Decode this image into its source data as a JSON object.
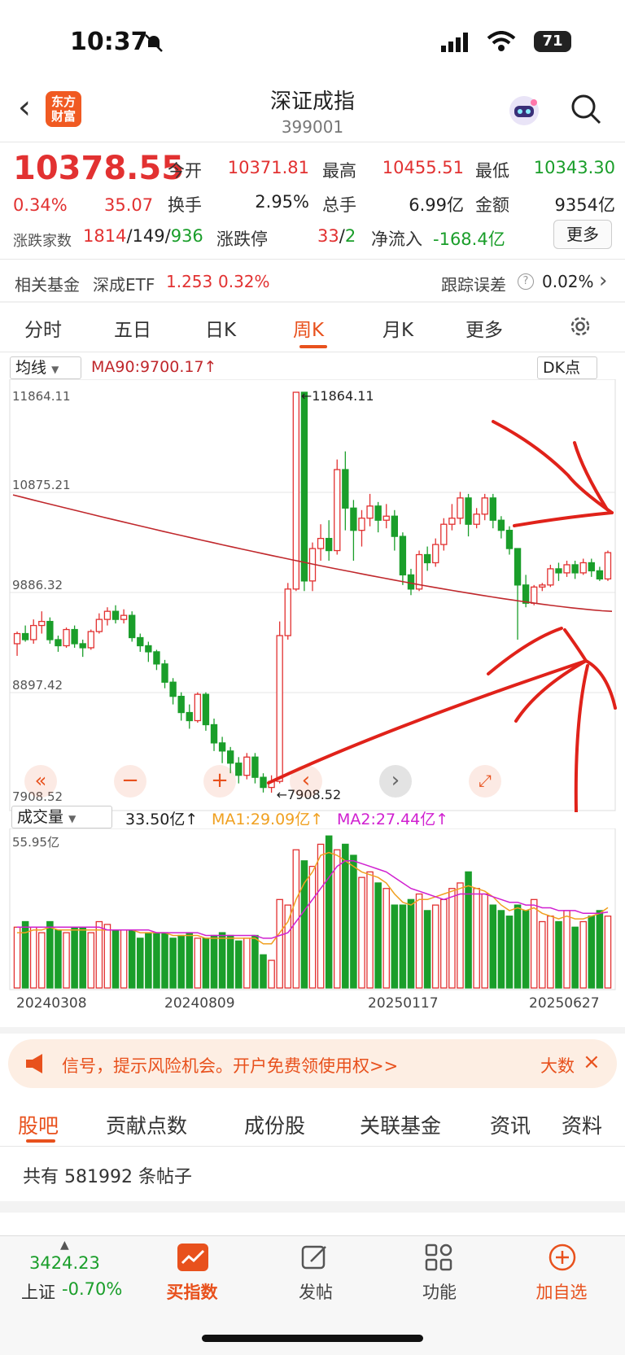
{
  "status": {
    "time": "10:37",
    "battery": "71"
  },
  "header": {
    "logo": "东方财富",
    "title": "深证成指",
    "code": "399001"
  },
  "quote": {
    "price": "10378.55",
    "change_pct": "0.34%",
    "change": "35.07",
    "rows": [
      [
        {
          "label": "今开",
          "value": "10371.81",
          "color": "red"
        },
        {
          "label": "最高",
          "value": "10455.51",
          "color": "red"
        },
        {
          "label": "最低",
          "value": "10343.30",
          "color": "green"
        }
      ],
      [
        {
          "label": "换手",
          "value": "2.95%",
          "color": "black"
        },
        {
          "label": "总手",
          "value": "6.99亿",
          "color": "black"
        },
        {
          "label": "金额",
          "value": "9354亿",
          "color": "black"
        }
      ]
    ],
    "breadth_label": "涨跌家数",
    "breadth_up": "1814",
    "breadth_flat": "149",
    "breadth_down": "936",
    "limit_label": "涨跌停",
    "limit_up": "33",
    "limit_down": "2",
    "netflow_label": "净流入",
    "netflow": "-168.4亿",
    "more": "更多"
  },
  "fund": {
    "label": "相关基金",
    "name": "深成ETF",
    "price": "1.253",
    "pct": "0.32%",
    "track_label": "跟踪误差",
    "track_val": "0.02%"
  },
  "tabs": [
    "分时",
    "五日",
    "日K",
    "周K",
    "月K",
    "更多"
  ],
  "active_tab": "周K",
  "chart_controls": {
    "ma_select": "均线",
    "ma90": "MA90:9700.17↑",
    "dk": "DK点"
  },
  "chart_data": [
    {
      "type": "candlestick",
      "y_ticks": [
        "11864.11",
        "10875.21",
        "9886.32",
        "8897.42",
        "7908.52"
      ],
      "ylim": [
        7908.52,
        11864.11
      ],
      "high_label": "←11864.11",
      "low_label": "←7908.52",
      "ma90_start": 10850,
      "ma90_end": 9700.17,
      "candles": [
        [
          9380,
          9480,
          9260,
          9500
        ],
        [
          9480,
          9420,
          9400,
          9560
        ],
        [
          9420,
          9560,
          9380,
          9620
        ],
        [
          9560,
          9600,
          9480,
          9700
        ],
        [
          9600,
          9420,
          9380,
          9640
        ],
        [
          9420,
          9360,
          9300,
          9460
        ],
        [
          9360,
          9520,
          9340,
          9540
        ],
        [
          9520,
          9380,
          9340,
          9560
        ],
        [
          9380,
          9340,
          9250,
          9420
        ],
        [
          9340,
          9500,
          9320,
          9520
        ],
        [
          9500,
          9620,
          9480,
          9680
        ],
        [
          9620,
          9700,
          9560,
          9740
        ],
        [
          9700,
          9620,
          9580,
          9760
        ],
        [
          9620,
          9660,
          9580,
          9720
        ],
        [
          9660,
          9440,
          9400,
          9700
        ],
        [
          9440,
          9360,
          9300,
          9480
        ],
        [
          9360,
          9300,
          9200,
          9400
        ],
        [
          9300,
          9180,
          9120,
          9320
        ],
        [
          9180,
          9000,
          8940,
          9220
        ],
        [
          9000,
          8860,
          8780,
          9040
        ],
        [
          8860,
          8700,
          8620,
          8900
        ],
        [
          8700,
          8620,
          8540,
          8780
        ],
        [
          8620,
          8880,
          8600,
          8900
        ],
        [
          8880,
          8580,
          8520,
          8900
        ],
        [
          8580,
          8400,
          8320,
          8640
        ],
        [
          8400,
          8320,
          8200,
          8460
        ],
        [
          8320,
          8200,
          8100,
          8360
        ],
        [
          8200,
          8080,
          8000,
          8260
        ],
        [
          8080,
          8260,
          8040,
          8300
        ],
        [
          8260,
          8060,
          8000,
          8300
        ],
        [
          8060,
          7960,
          7910,
          8100
        ],
        [
          7960,
          8020,
          7908,
          8080
        ],
        [
          8020,
          9460,
          8000,
          9600
        ],
        [
          9460,
          9920,
          9420,
          9980
        ],
        [
          9920,
          11864,
          9900,
          11864
        ],
        [
          11864,
          10000,
          9900,
          11700
        ],
        [
          10000,
          10320,
          9900,
          10380
        ],
        [
          10320,
          10420,
          10200,
          10560
        ],
        [
          10420,
          10300,
          10200,
          10600
        ],
        [
          10300,
          11100,
          10260,
          11200
        ],
        [
          11100,
          10720,
          10500,
          11280
        ],
        [
          10720,
          10500,
          10200,
          10800
        ],
        [
          10500,
          10620,
          10340,
          10700
        ],
        [
          10620,
          10740,
          10540,
          10860
        ],
        [
          10740,
          10600,
          10480,
          10780
        ],
        [
          10600,
          10640,
          10520,
          10760
        ],
        [
          10640,
          10440,
          10300,
          10700
        ],
        [
          10440,
          10060,
          9960,
          10480
        ],
        [
          10060,
          9920,
          9860,
          10120
        ],
        [
          9920,
          10260,
          9900,
          10300
        ],
        [
          10260,
          10180,
          10100,
          10340
        ],
        [
          10180,
          10360,
          10140,
          10420
        ],
        [
          10360,
          10560,
          10300,
          10620
        ],
        [
          10560,
          10620,
          10500,
          10760
        ],
        [
          10620,
          10820,
          10560,
          10880
        ],
        [
          10820,
          10560,
          10440,
          10860
        ],
        [
          10560,
          10660,
          10520,
          10720
        ],
        [
          10660,
          10820,
          10600,
          10860
        ],
        [
          10820,
          10600,
          10520,
          10860
        ],
        [
          10600,
          10500,
          10420,
          10640
        ],
        [
          10500,
          10320,
          10260,
          10540
        ],
        [
          10320,
          9960,
          9420,
          10300
        ],
        [
          9960,
          9780,
          9740,
          10060
        ],
        [
          9780,
          9940,
          9760,
          9960
        ],
        [
          9940,
          9960,
          9900,
          9980
        ],
        [
          9960,
          10120,
          9940,
          10160
        ],
        [
          10120,
          10080,
          10000,
          10180
        ],
        [
          10080,
          10160,
          10040,
          10200
        ],
        [
          10160,
          10080,
          10020,
          10200
        ],
        [
          10080,
          10180,
          10060,
          10220
        ],
        [
          10180,
          10100,
          10040,
          10220
        ],
        [
          10100,
          10020,
          10000,
          10140
        ],
        [
          10020,
          10280,
          10000,
          10300
        ]
      ]
    },
    {
      "type": "bar",
      "title": "成交量",
      "ymax_label": "55.95亿",
      "ymax": 55.95,
      "volume_label": "33.50亿↑",
      "ma1_label": "MA1:29.09亿↑",
      "ma2_label": "MA2:27.44亿↑",
      "x_labels": [
        "20240308",
        "20240809",
        "20250117",
        "20250627"
      ],
      "values": [
        22,
        24,
        22,
        20,
        24,
        21,
        20,
        22,
        22,
        20,
        24,
        23,
        21,
        21,
        21,
        18,
        20,
        20,
        20,
        18,
        19,
        20,
        18,
        18,
        19,
        20,
        19,
        17,
        18,
        19,
        12,
        10,
        32,
        30,
        50,
        46,
        44,
        52,
        55,
        50,
        52,
        48,
        40,
        42,
        38,
        36,
        30,
        30,
        32,
        34,
        28,
        30,
        32,
        36,
        38,
        42,
        36,
        34,
        30,
        28,
        26,
        30,
        28,
        32,
        24,
        26,
        24,
        28,
        22,
        24,
        26,
        28,
        26
      ],
      "ma1": [
        20,
        20,
        21,
        21,
        22,
        21,
        21,
        21,
        21,
        21,
        21,
        21,
        21,
        21,
        21,
        20,
        20,
        20,
        20,
        19,
        19,
        19,
        19,
        18,
        18,
        18,
        18,
        18,
        18,
        18,
        16,
        16,
        20,
        24,
        32,
        38,
        42,
        48,
        49,
        48,
        46,
        44,
        42,
        41,
        40,
        38,
        34,
        31,
        30,
        32,
        32,
        33,
        34,
        35,
        36,
        37,
        36,
        35,
        33,
        30,
        28,
        29,
        28,
        29,
        27,
        26,
        25,
        26,
        25,
        25,
        26,
        27,
        29.09
      ],
      "ma2": [
        22,
        22,
        22,
        22,
        22,
        22,
        22,
        22,
        22,
        22,
        22,
        21,
        21,
        21,
        21,
        21,
        21,
        20,
        20,
        20,
        20,
        20,
        20,
        19,
        19,
        19,
        19,
        19,
        19,
        19,
        18,
        18,
        19,
        20,
        24,
        28,
        32,
        36,
        40,
        44,
        46,
        46,
        45,
        44,
        43,
        42,
        40,
        38,
        36,
        35,
        34,
        33,
        32,
        33,
        34,
        34,
        34,
        34,
        33,
        32,
        31,
        31,
        30,
        30,
        29,
        29,
        28,
        28,
        28,
        27,
        27,
        27,
        27.44
      ],
      "colors": {
        "up": "#e23131",
        "down": "#1a9e2a",
        "ma1": "#f0a020",
        "ma2": "#d020d0",
        "ma90": "#c0282c"
      }
    }
  ],
  "banner": {
    "text": "信号，提示风险机会。开户免费领使用权>>",
    "right": "大数"
  },
  "bottom_tabs": [
    "股吧",
    "贡献点数",
    "成份股",
    "关联基金",
    "资讯",
    "资料"
  ],
  "posts_count": "共有 581992 条帖子",
  "nav": {
    "index_value": "3424.23",
    "index_name": "上证",
    "index_change": "-0.70%",
    "items": [
      "买指数",
      "发帖",
      "功能",
      "加自选"
    ]
  }
}
